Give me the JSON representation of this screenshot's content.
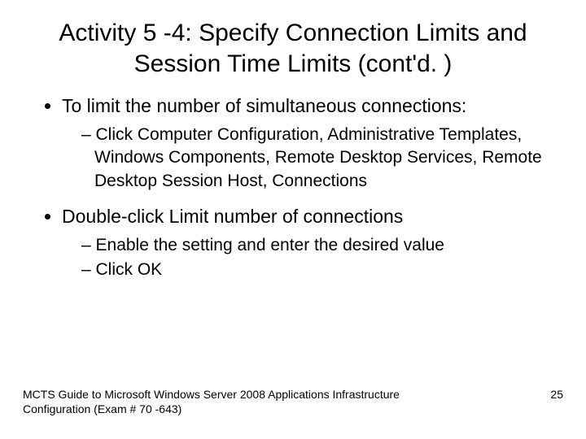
{
  "title": "Activity 5 -4: Specify Connection Limits and Session Time Limits (cont'd. )",
  "bullets": [
    {
      "text": "To limit the number of simultaneous connections:",
      "sub": [
        "Click Computer Configuration, Administrative Templates, Windows Components, Remote Desktop Services, Remote Desktop Session Host, Connections"
      ]
    },
    {
      "text": "Double-click Limit number of connections",
      "sub": [
        "Enable the setting and enter the desired value",
        "Click OK"
      ]
    }
  ],
  "footer": "MCTS Guide to Microsoft Windows Server 2008 Applications Infrastructure Configuration (Exam # 70 -643)",
  "page": "25"
}
